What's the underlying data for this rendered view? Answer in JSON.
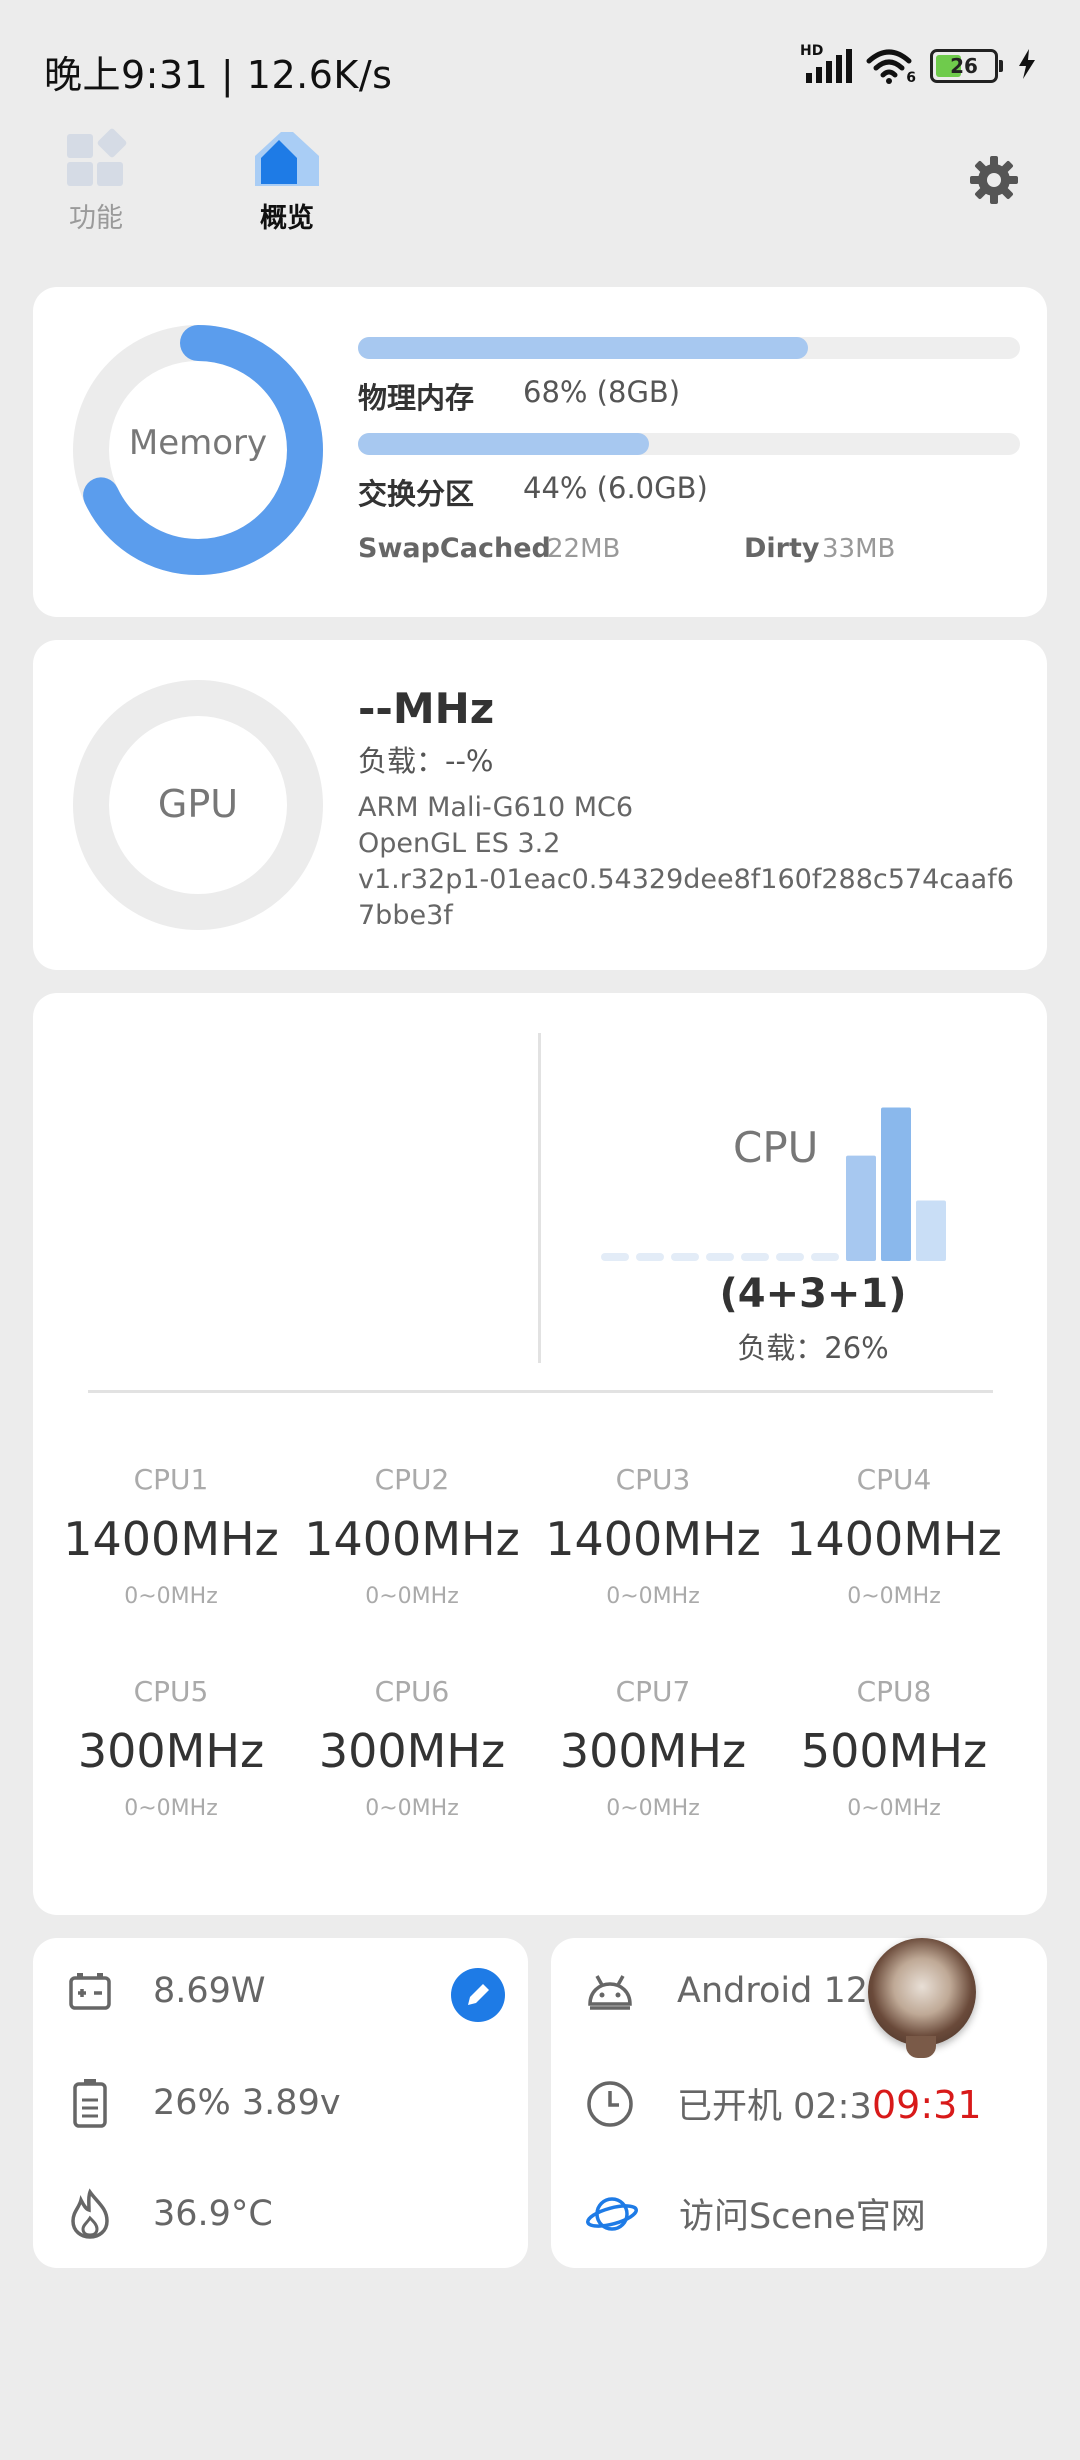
{
  "status_bar": {
    "time_speed": "晚上9:31 | 12.6K/s",
    "network_badge": "HD",
    "wifi_badge": "6",
    "battery_level": "26",
    "icons": [
      "signal-icon",
      "wifi-icon",
      "battery-icon",
      "charging-icon"
    ]
  },
  "tabs": [
    {
      "label": "功能",
      "icon": "grid-icon"
    },
    {
      "label": "概览",
      "icon": "home-icon"
    }
  ],
  "memory": {
    "ring_label": "Memory",
    "ring_percent": 68,
    "physical": {
      "label": "物理内存",
      "value": "68% (8GB)",
      "percent": 68
    },
    "swap": {
      "label": "交换分区",
      "value": "44% (6.0GB)",
      "percent": 44
    },
    "swap_cached": {
      "label": "SwapCached",
      "value": "22MB"
    },
    "dirty": {
      "label": "Dirty",
      "value": "33MB"
    }
  },
  "gpu": {
    "ring_label": "GPU",
    "freq": "--MHz",
    "load": "负载：--%",
    "model": "ARM Mali-G610 MC6",
    "api": "OpenGL ES 3.2",
    "driver": "v1.r32p1-01eac0.54329dee8f160f288c574caaf67bbe3f"
  },
  "cpu": {
    "title": "CPU",
    "cluster": "(4+3+1)",
    "load": "负载：26%",
    "bar_levels": [
      0.05,
      0.05,
      0.05,
      0.05,
      0.05,
      0.05,
      0.05,
      0.68,
      0.99,
      0.39
    ],
    "cores": [
      {
        "name": "CPU1",
        "freq": "1400MHz",
        "range": "0~0MHz"
      },
      {
        "name": "CPU2",
        "freq": "1400MHz",
        "range": "0~0MHz"
      },
      {
        "name": "CPU3",
        "freq": "1400MHz",
        "range": "0~0MHz"
      },
      {
        "name": "CPU4",
        "freq": "1400MHz",
        "range": "0~0MHz"
      },
      {
        "name": "CPU5",
        "freq": "300MHz",
        "range": "0~0MHz"
      },
      {
        "name": "CPU6",
        "freq": "300MHz",
        "range": "0~0MHz"
      },
      {
        "name": "CPU7",
        "freq": "300MHz",
        "range": "0~0MHz"
      },
      {
        "name": "CPU8",
        "freq": "500MHz",
        "range": "0~0MHz"
      }
    ]
  },
  "power": {
    "watts": "8.69W",
    "battery": "26%  3.89v",
    "temperature": "36.9°C"
  },
  "system": {
    "android": "Android 12",
    "uptime": "已开机  02:3",
    "clock_overlay": "09:31",
    "website": "访问Scene官网"
  },
  "colors": {
    "accent": "#5b9ded",
    "accent_light": "#a7c8f0",
    "edit_button": "#1e7be6",
    "overlay_time": "#d81a1a"
  }
}
